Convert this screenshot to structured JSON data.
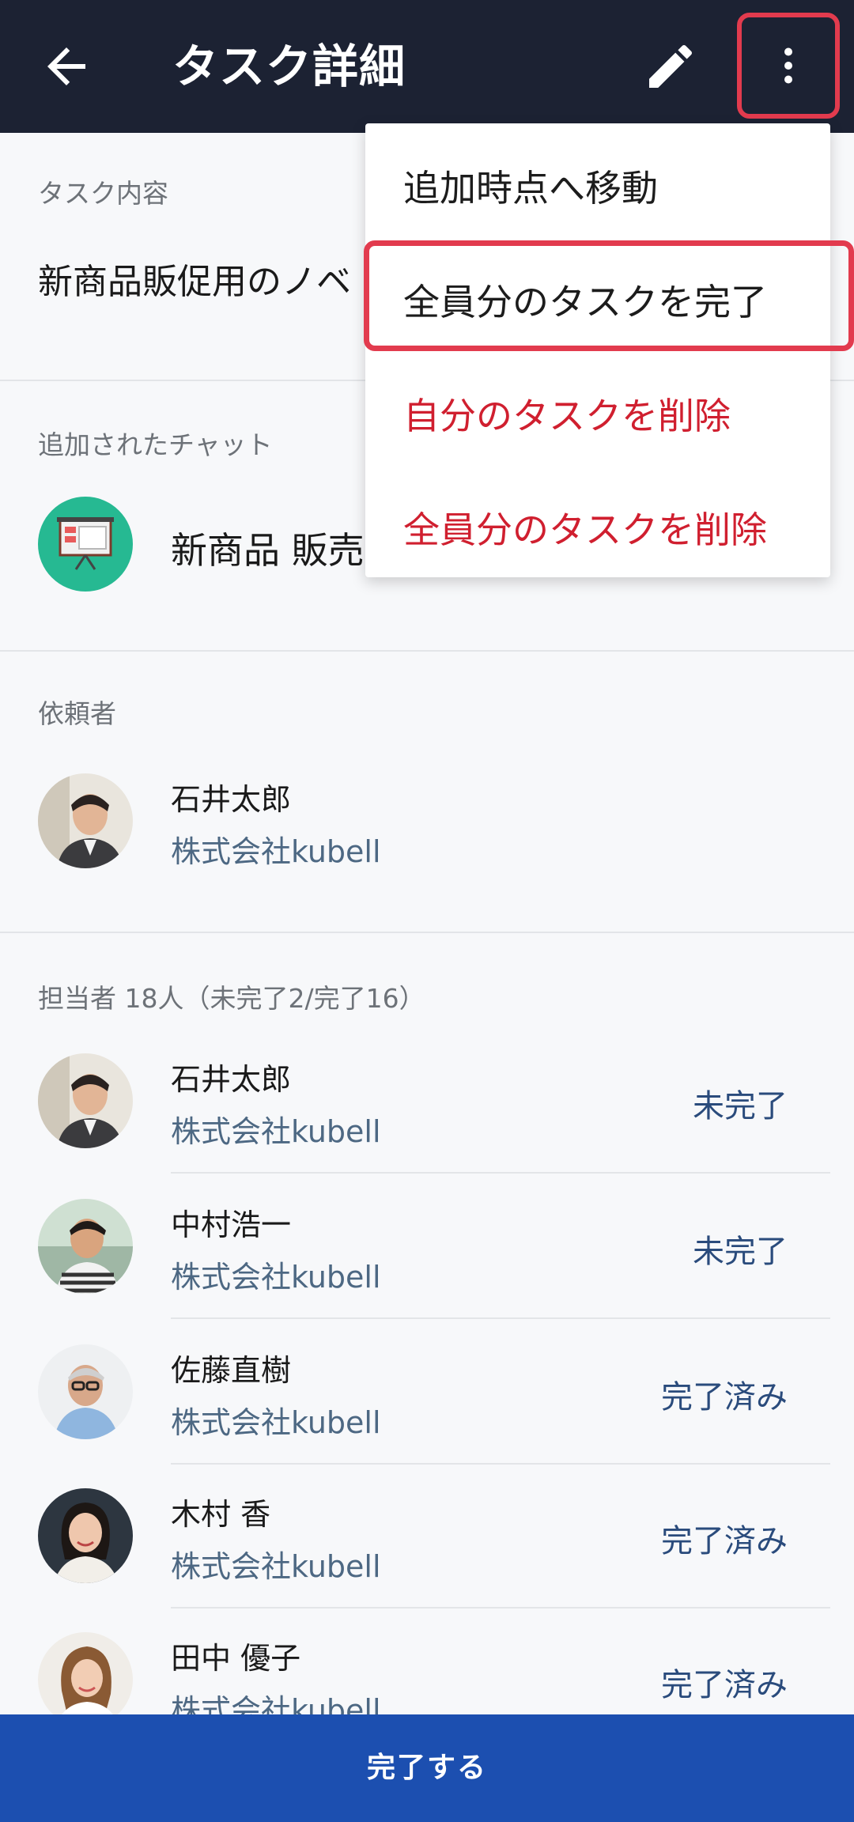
{
  "appbar": {
    "title": "タスク詳細",
    "back_icon": "arrow-left-icon",
    "edit_icon": "pencil-icon",
    "more_icon": "more-vertical-icon"
  },
  "task": {
    "section_label": "タスク内容",
    "content": "新商品販促用のノベ"
  },
  "chat": {
    "section_label": "追加されたチャット",
    "name": "新商品 販売"
  },
  "requester": {
    "section_label": "依頼者",
    "name": "石井太郎",
    "company": "株式会社kubell"
  },
  "assignees": {
    "section_label": "担当者 18人（未完了2/完了16）",
    "people": [
      {
        "name": "石井太郎",
        "company": "株式会社kubell",
        "status": "未完了"
      },
      {
        "name": "中村浩一",
        "company": "株式会社kubell",
        "status": "未完了"
      },
      {
        "name": "佐藤直樹",
        "company": "株式会社kubell",
        "status": "完了済み"
      },
      {
        "name": "木村 香",
        "company": "株式会社kubell",
        "status": "完了済み"
      },
      {
        "name": "田中 優子",
        "company": "株式会社kubell",
        "status": "完了済み"
      }
    ]
  },
  "menu": {
    "items": [
      {
        "label": "追加時点へ移動"
      },
      {
        "label": "全員分のタスクを完了"
      },
      {
        "label": "自分のタスクを削除"
      },
      {
        "label": "全員分のタスクを削除"
      }
    ]
  },
  "bottom_button": {
    "label": "完了する"
  },
  "colors": {
    "appbar": "#1c2233",
    "accent": "#1c4fb0",
    "danger": "#d01f2f",
    "highlight": "#e23b4e"
  }
}
